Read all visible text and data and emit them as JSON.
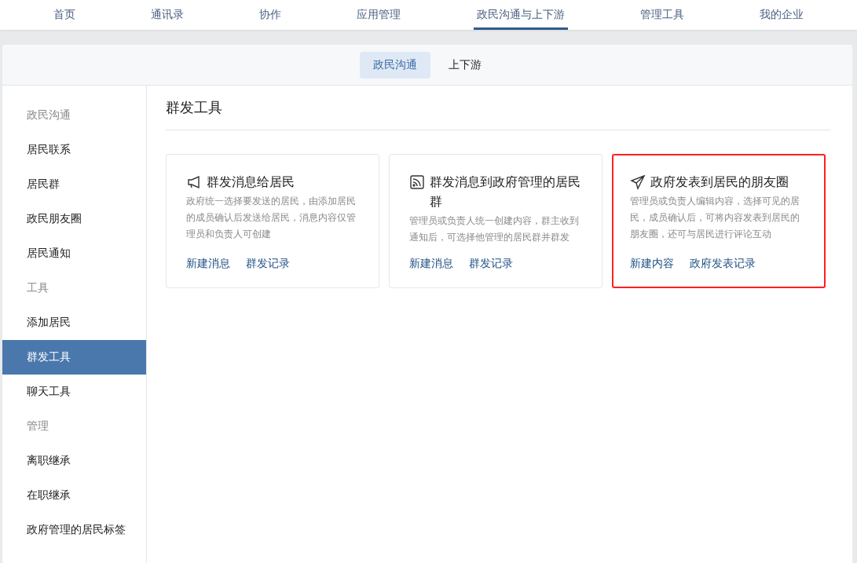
{
  "top_nav": [
    {
      "label": "首页",
      "selected": false
    },
    {
      "label": "通讯录",
      "selected": false
    },
    {
      "label": "协作",
      "selected": false
    },
    {
      "label": "应用管理",
      "selected": false
    },
    {
      "label": "政民沟通与上下游",
      "selected": true
    },
    {
      "label": "管理工具",
      "selected": false
    },
    {
      "label": "我的企业",
      "selected": false
    }
  ],
  "sub_tabs": [
    {
      "label": "政民沟通",
      "selected": true
    },
    {
      "label": "上下游",
      "selected": false
    }
  ],
  "sidebar": {
    "items": [
      {
        "kind": "heading",
        "label": "政民沟通",
        "selected": false
      },
      {
        "kind": "link",
        "label": "居民联系",
        "selected": false
      },
      {
        "kind": "link",
        "label": "居民群",
        "selected": false
      },
      {
        "kind": "link",
        "label": "政民朋友圈",
        "selected": false
      },
      {
        "kind": "link",
        "label": "居民通知",
        "selected": false
      },
      {
        "kind": "heading",
        "label": "工具",
        "selected": false
      },
      {
        "kind": "link",
        "label": "添加居民",
        "selected": false
      },
      {
        "kind": "link",
        "label": "群发工具",
        "selected": true
      },
      {
        "kind": "link",
        "label": "聊天工具",
        "selected": false
      },
      {
        "kind": "heading",
        "label": "管理",
        "selected": false
      },
      {
        "kind": "link",
        "label": "离职继承",
        "selected": false
      },
      {
        "kind": "link",
        "label": "在职继承",
        "selected": false
      },
      {
        "kind": "link",
        "label": "政府管理的居民标签",
        "selected": false
      }
    ]
  },
  "page_title": "群发工具",
  "cards": [
    {
      "kind": "megaphone",
      "title": "群发消息给居民",
      "description": "政府统一选择要发送的居民，由添加居民的成员确认后发送给居民，消息内容仅管理员和负责人可创建",
      "links": [
        "新建消息",
        "群发记录"
      ],
      "highlighted": false
    },
    {
      "kind": "feed",
      "title": "群发消息到政府管理的居民群",
      "description": "管理员或负责人统一创建内容，群主收到通知后，可选择他管理的居民群并群发",
      "links": [
        "新建消息",
        "群发记录"
      ],
      "highlighted": false
    },
    {
      "kind": "send",
      "title": "政府发表到居民的朋友圈",
      "description": "管理员或负责人编辑内容，选择可见的居民，成员确认后，可将内容发表到居民的朋友圈，还可与居民进行评论互动",
      "links": [
        "新建内容",
        "政府发表记录"
      ],
      "highlighted": true
    }
  ]
}
